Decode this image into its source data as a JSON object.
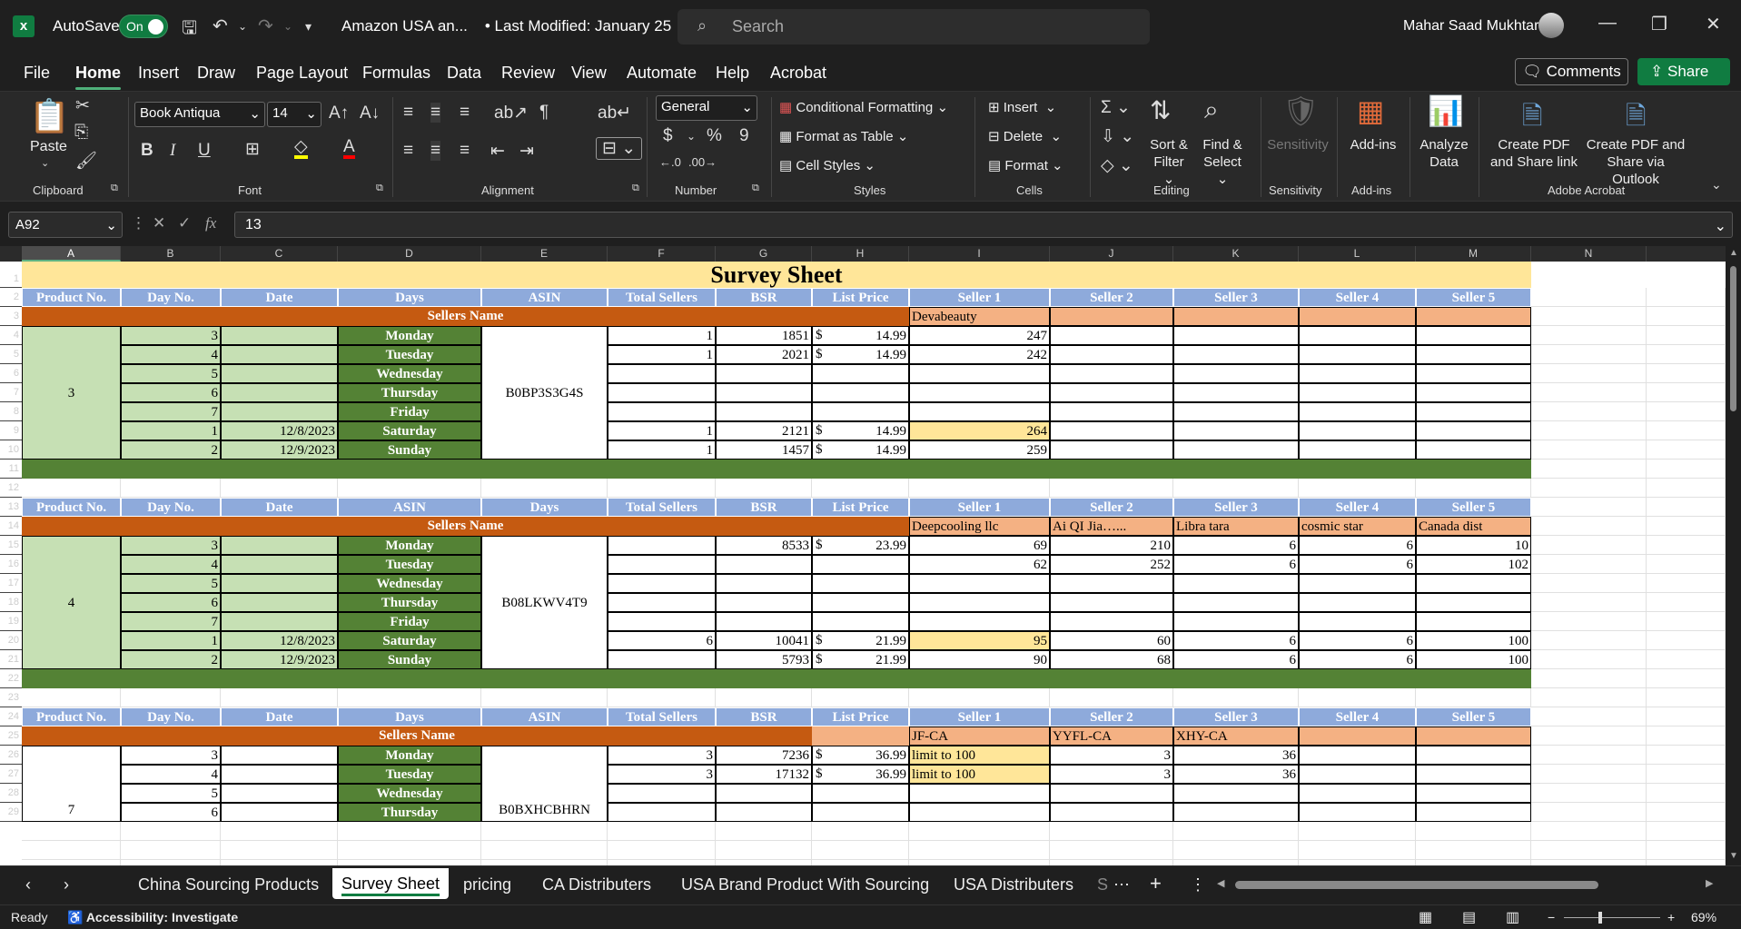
{
  "titlebar": {
    "autosave_label": "AutoSave",
    "autosave_state": "On",
    "doc_title": "Amazon USA an...",
    "last_modified": "• Last Modified: January 25",
    "search_placeholder": "Search",
    "user_name": "Mahar Saad Mukhtar"
  },
  "menu": {
    "items": [
      "File",
      "Home",
      "Insert",
      "Draw",
      "Page Layout",
      "Formulas",
      "Data",
      "Review",
      "View",
      "Automate",
      "Help",
      "Acrobat"
    ],
    "active": "Home",
    "comments_label": "Comments",
    "share_label": "Share"
  },
  "ribbon": {
    "clipboard": {
      "paste": "Paste",
      "label": "Clipboard"
    },
    "font": {
      "name": "Book Antiqua",
      "size": "14",
      "label": "Font"
    },
    "alignment": {
      "label": "Alignment"
    },
    "number": {
      "format": "General",
      "label": "Number"
    },
    "styles": {
      "conditional": "Conditional Formatting",
      "table": "Format as Table",
      "cell": "Cell Styles",
      "label": "Styles"
    },
    "cells": {
      "insert": "Insert",
      "delete": "Delete",
      "format": "Format",
      "label": "Cells"
    },
    "editing": {
      "sort1": "Sort &",
      "sort2": "Filter",
      "find1": "Find &",
      "find2": "Select",
      "label": "Editing"
    },
    "sensitivity": {
      "btn": "Sensitivity",
      "label": "Sensitivity"
    },
    "addins": {
      "btn": "Add-ins",
      "label": "Add-ins"
    },
    "analyze": {
      "l1": "Analyze",
      "l2": "Data"
    },
    "acrobat": {
      "a1": "Create PDF",
      "a2": "and Share link",
      "b1": "Create PDF and",
      "b2": "Share via Outlook",
      "label": "Adobe Acrobat"
    }
  },
  "formula_bar": {
    "name_box": "A92",
    "fx": "fx",
    "value": "13"
  },
  "columns": [
    "A",
    "B",
    "C",
    "D",
    "E",
    "F",
    "G",
    "H",
    "I",
    "J",
    "K",
    "L",
    "M",
    "N"
  ],
  "rows": [
    "1",
    "2",
    "3",
    "4",
    "5",
    "6",
    "7",
    "8",
    "9",
    "10",
    "11",
    "12",
    "13",
    "14",
    "15",
    "16",
    "17",
    "18",
    "19",
    "20",
    "21",
    "22",
    "23",
    "24",
    "25",
    "26",
    "27",
    "28",
    "29"
  ],
  "sheet": {
    "title": "Survey Sheet",
    "hdr1": [
      "Product No.",
      "Day No.",
      "Date",
      "Days",
      "ASIN",
      "Total Sellers",
      "BSR",
      "List Price",
      "Seller 1",
      "Seller 2",
      "Seller 3",
      "Seller 4",
      "Seller 5"
    ],
    "hdr2": [
      "Product No.",
      "Day No.",
      "Date",
      "ASIN",
      "Days",
      "Total Sellers",
      "BSR",
      "List Price",
      "Seller 1",
      "Seller 2",
      "Seller 3",
      "Seller 4",
      "Seller 5"
    ],
    "hdr3": [
      "Product No.",
      "Day No.",
      "Date",
      "Days",
      "ASIN",
      "Total Sellers",
      "BSR",
      "List Price",
      "Seller 1",
      "Seller 2",
      "Seller 3",
      "Seller 4",
      "Seller 5"
    ],
    "sellers_name": "Sellers Name",
    "block1": {
      "product": "3",
      "asin": "B0BP3S3G4S",
      "sellers": [
        "Devabeauty",
        "",
        "",
        "",
        ""
      ],
      "rows": [
        {
          "day": "3",
          "date": "",
          "dayname": "Monday",
          "total": "1",
          "bsr": "1851",
          "cur": "$",
          "price": "14.99",
          "s1": "247",
          "s2": "",
          "s3": "",
          "s4": "",
          "s5": ""
        },
        {
          "day": "4",
          "date": "",
          "dayname": "Tuesday",
          "total": "1",
          "bsr": "2021",
          "cur": "$",
          "price": "14.99",
          "s1": "242",
          "s2": "",
          "s3": "",
          "s4": "",
          "s5": ""
        },
        {
          "day": "5",
          "date": "",
          "dayname": "Wednesday",
          "total": "",
          "bsr": "",
          "cur": "",
          "price": "",
          "s1": "",
          "s2": "",
          "s3": "",
          "s4": "",
          "s5": ""
        },
        {
          "day": "6",
          "date": "",
          "dayname": "Thursday",
          "total": "",
          "bsr": "",
          "cur": "",
          "price": "",
          "s1": "",
          "s2": "",
          "s3": "",
          "s4": "",
          "s5": ""
        },
        {
          "day": "7",
          "date": "",
          "dayname": "Friday",
          "total": "",
          "bsr": "",
          "cur": "",
          "price": "",
          "s1": "",
          "s2": "",
          "s3": "",
          "s4": "",
          "s5": ""
        },
        {
          "day": "1",
          "date": "12/8/2023",
          "dayname": "Saturday",
          "total": "1",
          "bsr": "2121",
          "cur": "$",
          "price": "14.99",
          "s1": "264",
          "s2": "",
          "s3": "",
          "s4": "",
          "s5": ""
        },
        {
          "day": "2",
          "date": "12/9/2023",
          "dayname": "Sunday",
          "total": "1",
          "bsr": "1457",
          "cur": "$",
          "price": "14.99",
          "s1": "259",
          "s2": "",
          "s3": "",
          "s4": "",
          "s5": ""
        }
      ]
    },
    "block2": {
      "product": "4",
      "asin": "B08LKWV4T9",
      "sellers": [
        "Deepcooling llc",
        "Ai QI Jia…...",
        "Libra tara",
        "cosmic star",
        "Canada dist"
      ],
      "rows": [
        {
          "day": "3",
          "date": "",
          "dayname": "Monday",
          "total": "",
          "bsr": "8533",
          "cur": "$",
          "price": "23.99",
          "s1": "69",
          "s2": "210",
          "s3": "6",
          "s4": "6",
          "s5": "10"
        },
        {
          "day": "4",
          "date": "",
          "dayname": "Tuesday",
          "total": "",
          "bsr": "",
          "cur": "",
          "price": "",
          "s1": "62",
          "s2": "252",
          "s3": "6",
          "s4": "6",
          "s5": "102"
        },
        {
          "day": "5",
          "date": "",
          "dayname": "Wednesday",
          "total": "",
          "bsr": "",
          "cur": "",
          "price": "",
          "s1": "",
          "s2": "",
          "s3": "",
          "s4": "",
          "s5": ""
        },
        {
          "day": "6",
          "date": "",
          "dayname": "Thursday",
          "total": "",
          "bsr": "",
          "cur": "",
          "price": "",
          "s1": "",
          "s2": "",
          "s3": "",
          "s4": "",
          "s5": ""
        },
        {
          "day": "7",
          "date": "",
          "dayname": "Friday",
          "total": "",
          "bsr": "",
          "cur": "",
          "price": "",
          "s1": "",
          "s2": "",
          "s3": "",
          "s4": "",
          "s5": ""
        },
        {
          "day": "1",
          "date": "12/8/2023",
          "dayname": "Saturday",
          "total": "6",
          "bsr": "10041",
          "cur": "$",
          "price": "21.99",
          "s1": "95",
          "s2": "60",
          "s3": "6",
          "s4": "6",
          "s5": "100"
        },
        {
          "day": "2",
          "date": "12/9/2023",
          "dayname": "Sunday",
          "total": "",
          "bsr": "5793",
          "cur": "$",
          "price": "21.99",
          "s1": "90",
          "s2": "68",
          "s3": "6",
          "s4": "6",
          "s5": "100"
        }
      ]
    },
    "block3": {
      "product": "7",
      "asin": "B0BXHCBHRN",
      "sellers": [
        "JF-CA",
        "YYFL-CA",
        "XHY-CA",
        "",
        ""
      ],
      "rows": [
        {
          "day": "3",
          "date": "",
          "dayname": "Monday",
          "total": "3",
          "bsr": "7236",
          "cur": "$",
          "price": "36.99",
          "s1": "limit to 100",
          "s2": "3",
          "s3": "36",
          "s4": "",
          "s5": ""
        },
        {
          "day": "4",
          "date": "",
          "dayname": "Tuesday",
          "total": "3",
          "bsr": "17132",
          "cur": "$",
          "price": "36.99",
          "s1": "limit to 100",
          "s2": "3",
          "s3": "36",
          "s4": "",
          "s5": ""
        },
        {
          "day": "5",
          "date": "",
          "dayname": "Wednesday",
          "total": "",
          "bsr": "",
          "cur": "",
          "price": "",
          "s1": "",
          "s2": "",
          "s3": "",
          "s4": "",
          "s5": ""
        },
        {
          "day": "6",
          "date": "",
          "dayname": "Thursday",
          "total": "",
          "bsr": "",
          "cur": "",
          "price": "",
          "s1": "",
          "s2": "",
          "s3": "",
          "s4": "",
          "s5": ""
        }
      ]
    }
  },
  "tabs": [
    "China Sourcing Products",
    "Survey Sheet",
    "pricing",
    "CA Distributers",
    "USA Brand Product With Sourcing",
    "USA Distributers",
    "S"
  ],
  "active_tab": "Survey Sheet",
  "status": {
    "ready": "Ready",
    "accessibility": "Accessibility: Investigate",
    "zoom": "69%"
  },
  "colors": {
    "accent": "#107c41",
    "header_blue": "#8eaadb",
    "orange": "#c55a11",
    "peach": "#f4b183",
    "light_green": "#c6e0b4",
    "dark_green": "#548235",
    "yellow": "#ffe699",
    "title_bg": "#ffe699"
  }
}
